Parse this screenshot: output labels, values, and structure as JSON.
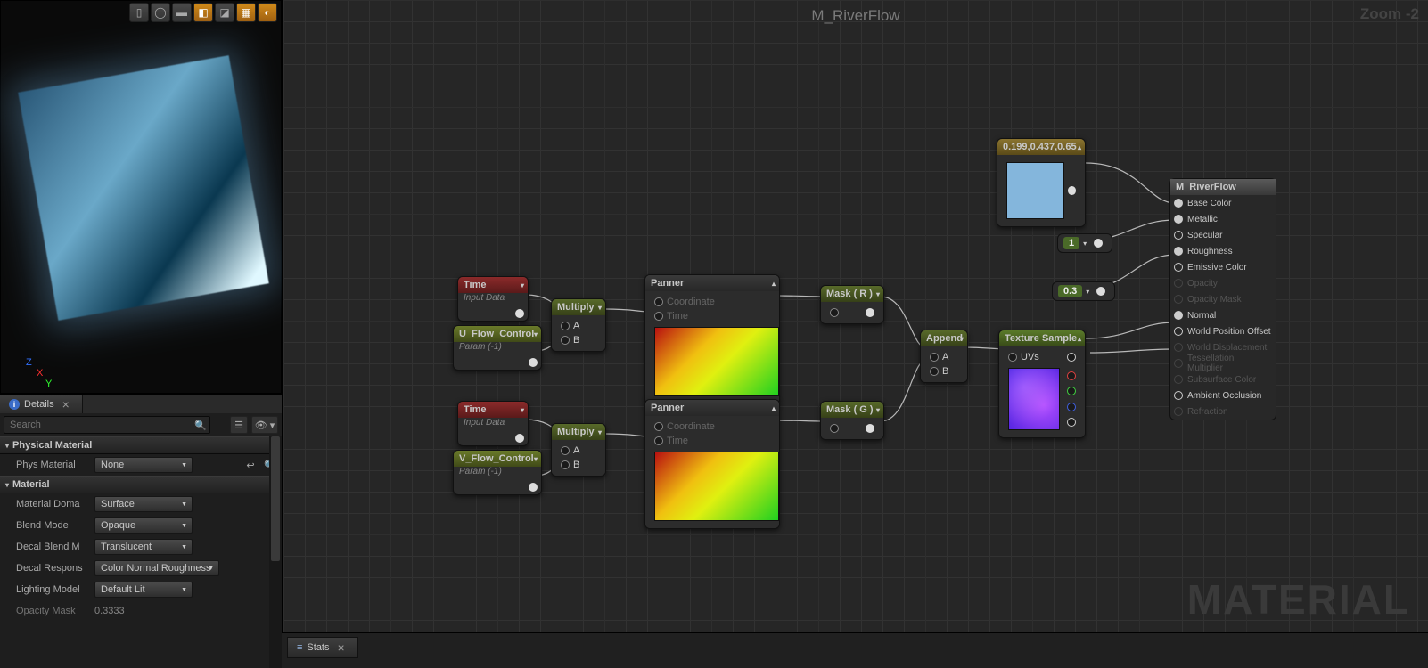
{
  "graph": {
    "title": "M_RiverFlow",
    "zoom": "Zoom -2",
    "watermark": "MATERIAL"
  },
  "preview_tools": [
    "cylinder",
    "sphere",
    "plane",
    "cube",
    "teapot",
    "grid",
    "no-light"
  ],
  "details": {
    "tab_label": "Details",
    "search_placeholder": "Search",
    "sections": {
      "physmat": {
        "title": "Physical Material",
        "phys_label": "Phys Material",
        "phys_value": "None"
      },
      "material": {
        "title": "Material",
        "domain_label": "Material Doma",
        "domain_value": "Surface",
        "blend_label": "Blend Mode",
        "blend_value": "Opaque",
        "decalblend_label": "Decal Blend M",
        "decalblend_value": "Translucent",
        "decalresp_label": "Decal Respons",
        "decalresp_value": "Color Normal Roughness",
        "lighting_label": "Lighting Model",
        "lighting_value": "Default Lit",
        "opmask_label": "Opacity Mask",
        "opmask_value": "0.3333"
      }
    }
  },
  "nodes": {
    "time1": {
      "title": "Time",
      "sub": "Input Data"
    },
    "time2": {
      "title": "Time",
      "sub": "Input Data"
    },
    "uflow": {
      "title": "U_Flow_Control",
      "sub": "Param (-1)"
    },
    "vflow": {
      "title": "V_Flow_Control",
      "sub": "Param (-1)"
    },
    "mult1": {
      "title": "Multiply",
      "a": "A",
      "b": "B"
    },
    "mult2": {
      "title": "Multiply",
      "a": "A",
      "b": "B"
    },
    "panner1": {
      "title": "Panner",
      "coord": "Coordinate",
      "time": "Time"
    },
    "panner2": {
      "title": "Panner",
      "coord": "Coordinate",
      "time": "Time"
    },
    "maskr": {
      "title": "Mask ( R )"
    },
    "maskg": {
      "title": "Mask ( G )"
    },
    "append": {
      "title": "Append",
      "a": "A",
      "b": "B"
    },
    "texsample": {
      "title": "Texture Sample",
      "uvs": "UVs"
    },
    "colorconst": {
      "title": "0.199,0.437,0.65"
    },
    "const1": "1",
    "const03": "0.3"
  },
  "result": {
    "title": "M_RiverFlow",
    "pins": [
      {
        "label": "Base Color",
        "active": true
      },
      {
        "label": "Metallic",
        "active": true
      },
      {
        "label": "Specular",
        "active": true,
        "ring": true
      },
      {
        "label": "Roughness",
        "active": true
      },
      {
        "label": "Emissive Color",
        "active": true,
        "ring": true
      },
      {
        "label": "Opacity",
        "active": false
      },
      {
        "label": "Opacity Mask",
        "active": false
      },
      {
        "label": "Normal",
        "active": true
      },
      {
        "label": "World Position Offset",
        "active": true,
        "ring": true
      },
      {
        "label": "World Displacement",
        "active": false
      },
      {
        "label": "Tessellation Multiplier",
        "active": false
      },
      {
        "label": "Subsurface Color",
        "active": false
      },
      {
        "label": "Ambient Occlusion",
        "active": true,
        "ring": true
      },
      {
        "label": "Refraction",
        "active": false
      }
    ]
  },
  "stats": {
    "label": "Stats"
  }
}
